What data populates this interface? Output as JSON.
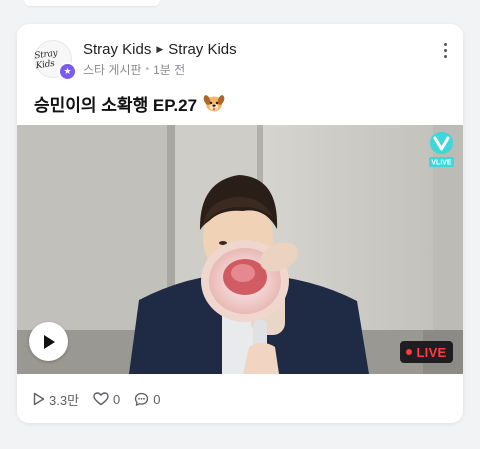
{
  "post": {
    "board_name": "Stray Kids",
    "artist_name": "Stray Kids",
    "board_type": "스타 게시판",
    "time_ago": "1분 전",
    "title": "승민이의 소확행 EP.27"
  },
  "avatar": {
    "logo_text": "Stray Kids"
  },
  "icons": {
    "avatar": "stray-kids-logo",
    "verified": "star-badge-icon",
    "more": "more-vertical-icon",
    "title_emoji": "dog-face-emoji",
    "vlive": "vlive-logo",
    "play": "play-icon",
    "views": "play-outline-icon",
    "likes": "heart-outline-icon",
    "comments": "comment-icon"
  },
  "video": {
    "vlive_label": "VLIVE",
    "live_label": "LIVE"
  },
  "stats": {
    "views": "3.3만",
    "likes": "0",
    "comments": "0"
  },
  "colors": {
    "accent_purple": "#7b5cf0",
    "vlive_cyan": "#3fd6dc",
    "live_red": "#ff3b3b"
  }
}
